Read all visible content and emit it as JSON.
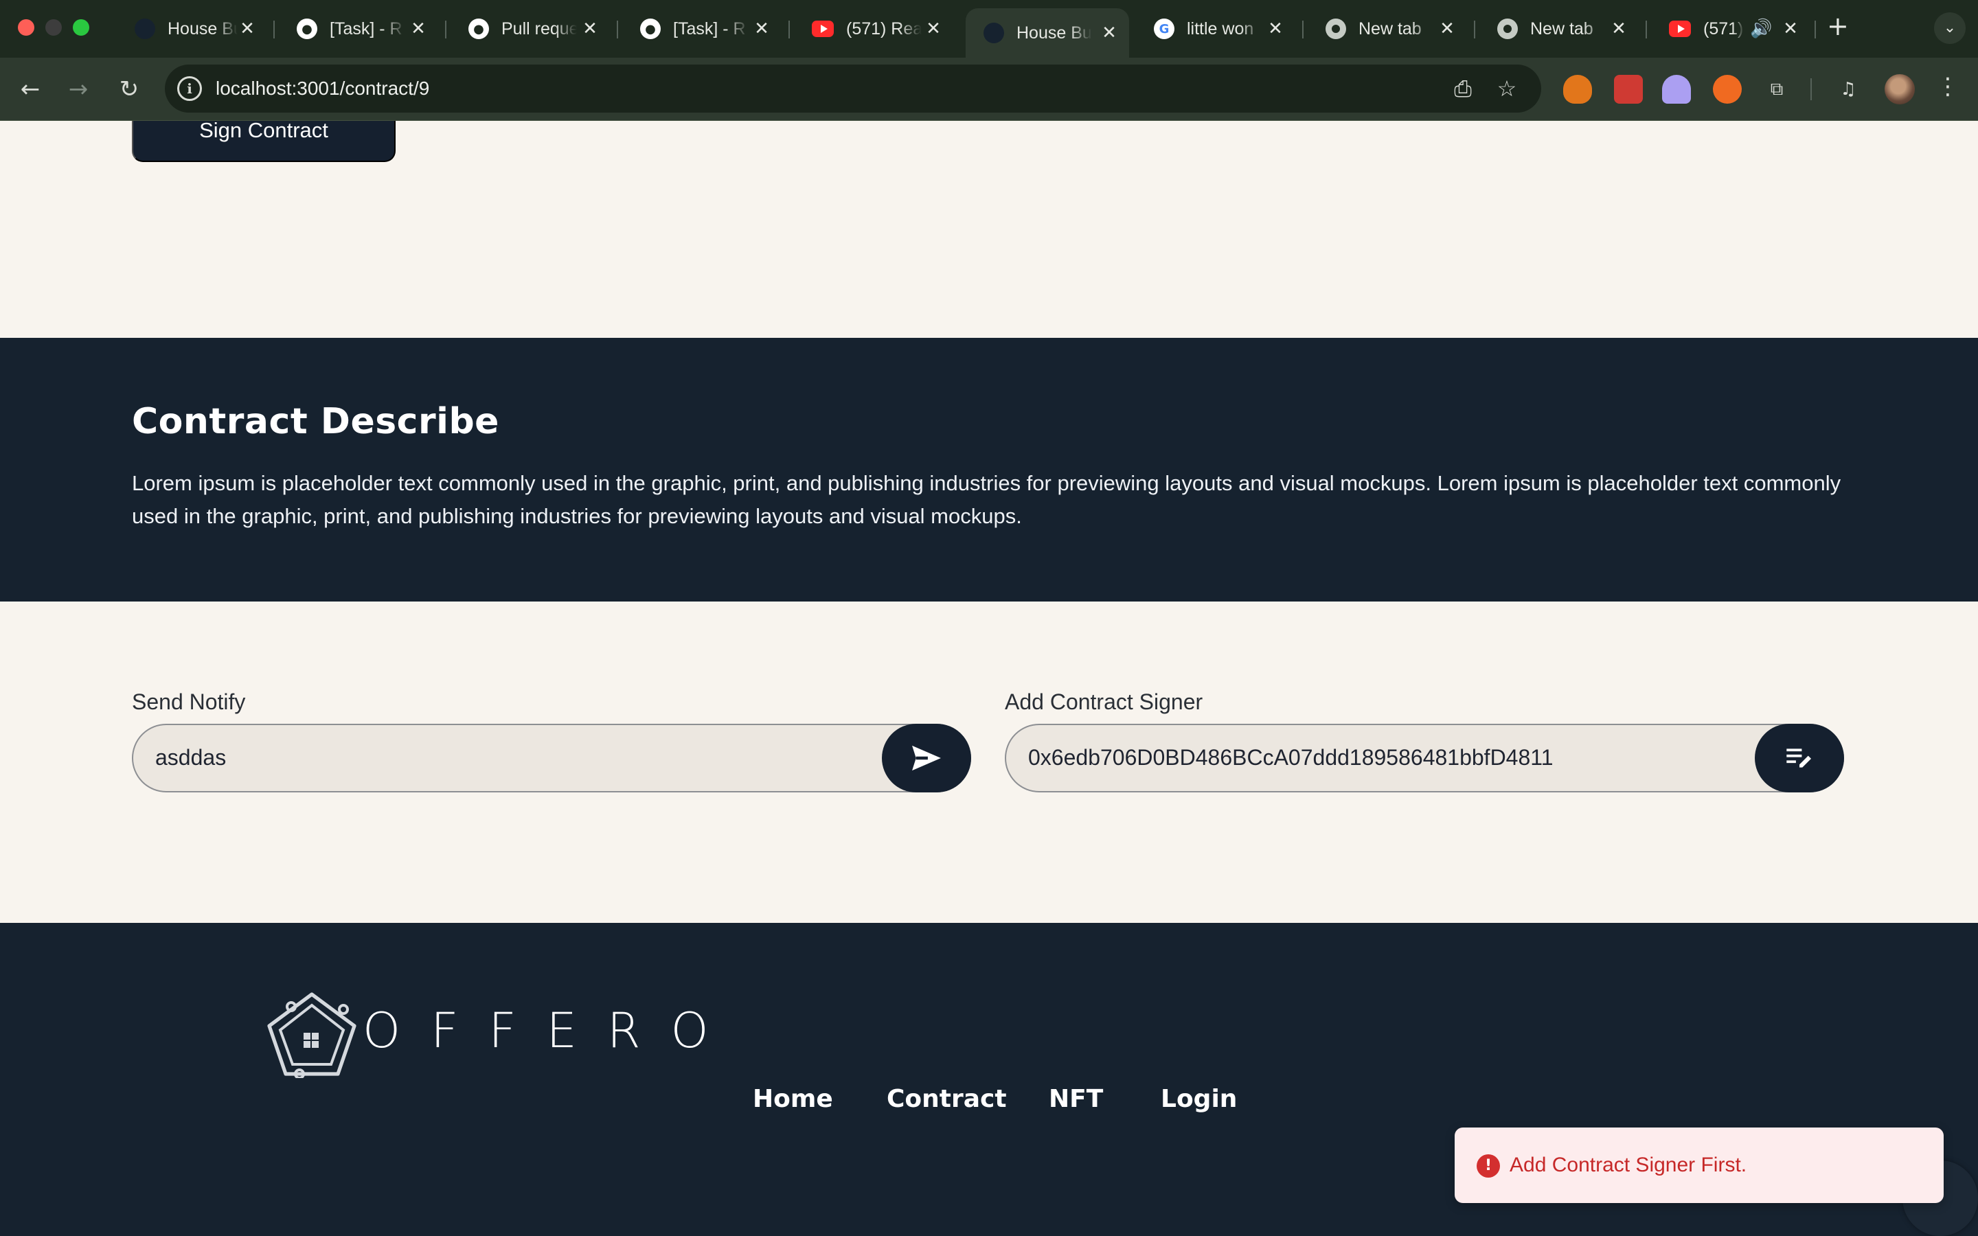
{
  "browser": {
    "tabs": [
      {
        "title": "House Bu",
        "icon": "house-favicon",
        "active": false
      },
      {
        "title": "[Task] - R",
        "icon": "github-icon",
        "active": false
      },
      {
        "title": "Pull reque",
        "icon": "github-icon",
        "active": false
      },
      {
        "title": "[Task] - R",
        "icon": "github-icon",
        "active": false
      },
      {
        "title": "(571) Rea",
        "icon": "youtube-icon",
        "active": false
      },
      {
        "title": "House Bu",
        "icon": "house-favicon",
        "active": true
      },
      {
        "title": "little won",
        "icon": "google-icon",
        "active": false
      },
      {
        "title": "New tab",
        "icon": "chrome-icon",
        "active": false
      },
      {
        "title": "New tab",
        "icon": "chrome-icon",
        "active": false
      },
      {
        "title": "(571)",
        "icon": "youtube-icon",
        "active": false,
        "audio": true
      }
    ],
    "url": "localhost:3001/contract/9"
  },
  "page": {
    "sign_button": "Sign Contract",
    "describe": {
      "title": "Contract Describe",
      "text": "Lorem ipsum is placeholder text commonly used in the graphic, print, and publishing industries for previewing layouts and visual mockups. Lorem ipsum is placeholder text commonly used in the graphic, print, and publishing industries for previewing layouts and visual mockups."
    },
    "send_notify": {
      "label": "Send Notify",
      "value": "asddas"
    },
    "add_signer": {
      "label": "Add Contract Signer",
      "value": "0x6edb706D0BD486BCcA07ddd189586481bbfD4811"
    }
  },
  "footer": {
    "brand": "OFFERO",
    "nav": [
      "Home",
      "Contract",
      "NFT",
      "Login"
    ]
  },
  "toast": {
    "message": "Add Contract Signer First.",
    "type": "error"
  },
  "colors": {
    "navy": "#16222f",
    "cream": "#f8f4ee",
    "error": "#c62828"
  }
}
